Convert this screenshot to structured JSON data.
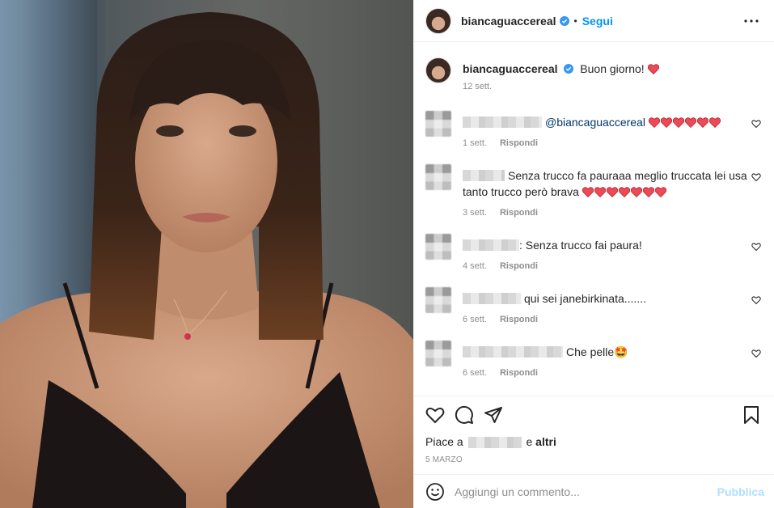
{
  "post": {
    "image_alt": "Woman with dark bob haircut and bangs taking a selfie",
    "author": "biancaguaccereal",
    "follow_label": "Segui",
    "separator": "•"
  },
  "caption": {
    "author": "biancaguaccereal",
    "text": "Buon giorno!",
    "time": "12 sett."
  },
  "comments": [
    {
      "text": "@biancaguaccereal",
      "hearts": 6,
      "time": "1 sett.",
      "reply": "Rispondi"
    },
    {
      "text": "Senza trucco fa pauraaa meglio truccata lei usa tanto trucco però brava",
      "hearts": 7,
      "time": "3 sett.",
      "reply": "Rispondi"
    },
    {
      "text": ": Senza trucco fai paura!",
      "hearts": 0,
      "time": "4 sett.",
      "reply": "Rispondi"
    },
    {
      "text": "qui sei janebirkinata.......",
      "hearts": 0,
      "time": "6 sett.",
      "reply": "Rispondi"
    },
    {
      "text": "Che pelle🤩",
      "hearts": 0,
      "time": "6 sett.",
      "reply": "Rispondi"
    }
  ],
  "likes": {
    "prefix": "Piace a",
    "middle": "e",
    "others": "altri"
  },
  "date": "5 MARZO",
  "add_comment": {
    "placeholder": "Aggiungi un commento...",
    "publish": "Pubblica"
  },
  "colors": {
    "accent": "#0095f6",
    "heart": "#ed4956",
    "muted": "#8e8e8e"
  }
}
